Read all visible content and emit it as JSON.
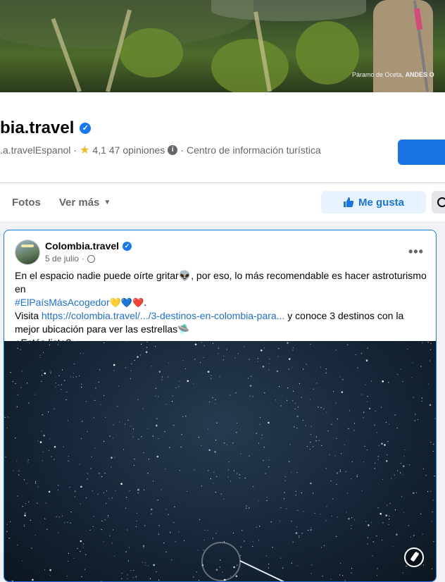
{
  "cover": {
    "caption_place": "Páramo de Oceta,",
    "caption_region": "ANDES O"
  },
  "page": {
    "name": "bia.travel",
    "username": ".a.travelEspanol",
    "separator": "·",
    "rating": "4,1",
    "reviews": "47 opiniones",
    "category": "Centro de información turística"
  },
  "tabs": {
    "photos": "Fotos",
    "more": "Ver más"
  },
  "actions": {
    "like": "Me gusta"
  },
  "post": {
    "author": "Colombia.travel",
    "date": "5 de julio",
    "line1": "En el espacio nadie puede oírte gritar👽, por eso, lo más recomendable es hacer astroturismo en",
    "hashtag": "#ElPaísMásAcogedor",
    "hashtag_emojis": "💛💙❤️",
    "hashtag_tail": ".",
    "visit_prefix": "Visita ",
    "link": "https://colombia.travel/.../3-destinos-en-colombia-para...",
    "visit_suffix": " y conoce 3 destinos con la mejor ubicación para ver las estrellas🛸",
    "question": "¿Estás listo?"
  }
}
